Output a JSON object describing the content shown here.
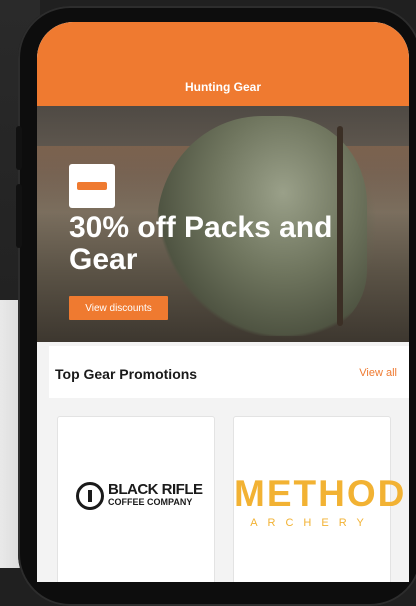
{
  "header": {
    "title": "Hunting Gear"
  },
  "hero": {
    "headline": "30% off Packs and Gear",
    "cta_label": "View discounts"
  },
  "promotions": {
    "title": "Top Gear Promotions",
    "view_all_label": "View all",
    "cards": [
      {
        "brand_line1": "BLACK RIFLE",
        "brand_line2": "COFFEE COMPANY"
      },
      {
        "brand_line1": "METHOD",
        "brand_line2": "ARCHERY"
      }
    ]
  },
  "colors": {
    "accent": "#ef7a30",
    "method_gold": "#f2b233"
  }
}
